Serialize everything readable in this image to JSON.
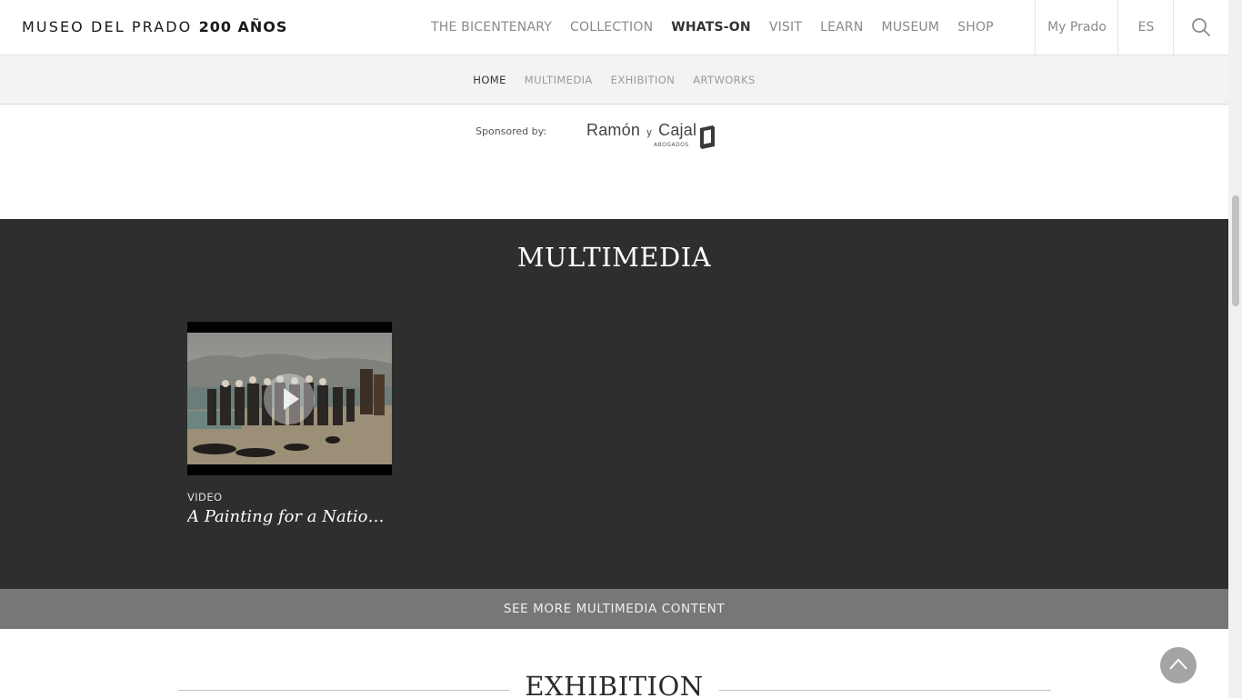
{
  "header": {
    "logo_main": "MUSEO DEL PRADO",
    "logo_bold": "200 AÑOS",
    "nav": [
      {
        "label": "THE BICENTENARY"
      },
      {
        "label": "COLLECTION"
      },
      {
        "label": "WHATS-ON"
      },
      {
        "label": "VISIT"
      },
      {
        "label": "LEARN"
      },
      {
        "label": "MUSEUM"
      },
      {
        "label": "SHOP"
      }
    ],
    "active_nav": "WHATS-ON",
    "my_prado": "My Prado",
    "language": "ES",
    "search_icon": "search-icon"
  },
  "subnav": {
    "items": [
      {
        "label": "HOME"
      },
      {
        "label": "MULTIMEDIA"
      },
      {
        "label": "EXHIBITION"
      },
      {
        "label": "ARTWORKS"
      }
    ],
    "active": "HOME"
  },
  "sponsor": {
    "label": "Sponsored by:",
    "name_part1": "Ramón",
    "name_y": "y",
    "name_part2": "Cajal",
    "sub": "ABOGADOS"
  },
  "multimedia": {
    "title": "MULTIMEDIA",
    "cards": [
      {
        "type": "VIDEO",
        "title": "A Painting for a Nation. T..."
      }
    ],
    "see_more": "SEE MORE MULTIMEDIA CONTENT"
  },
  "exhibition": {
    "title": "EXHIBITION"
  },
  "colors": {
    "dark_section": "#2e2e2e",
    "see_more_bar": "#777777",
    "subnav_bg": "#f3f3f3"
  }
}
